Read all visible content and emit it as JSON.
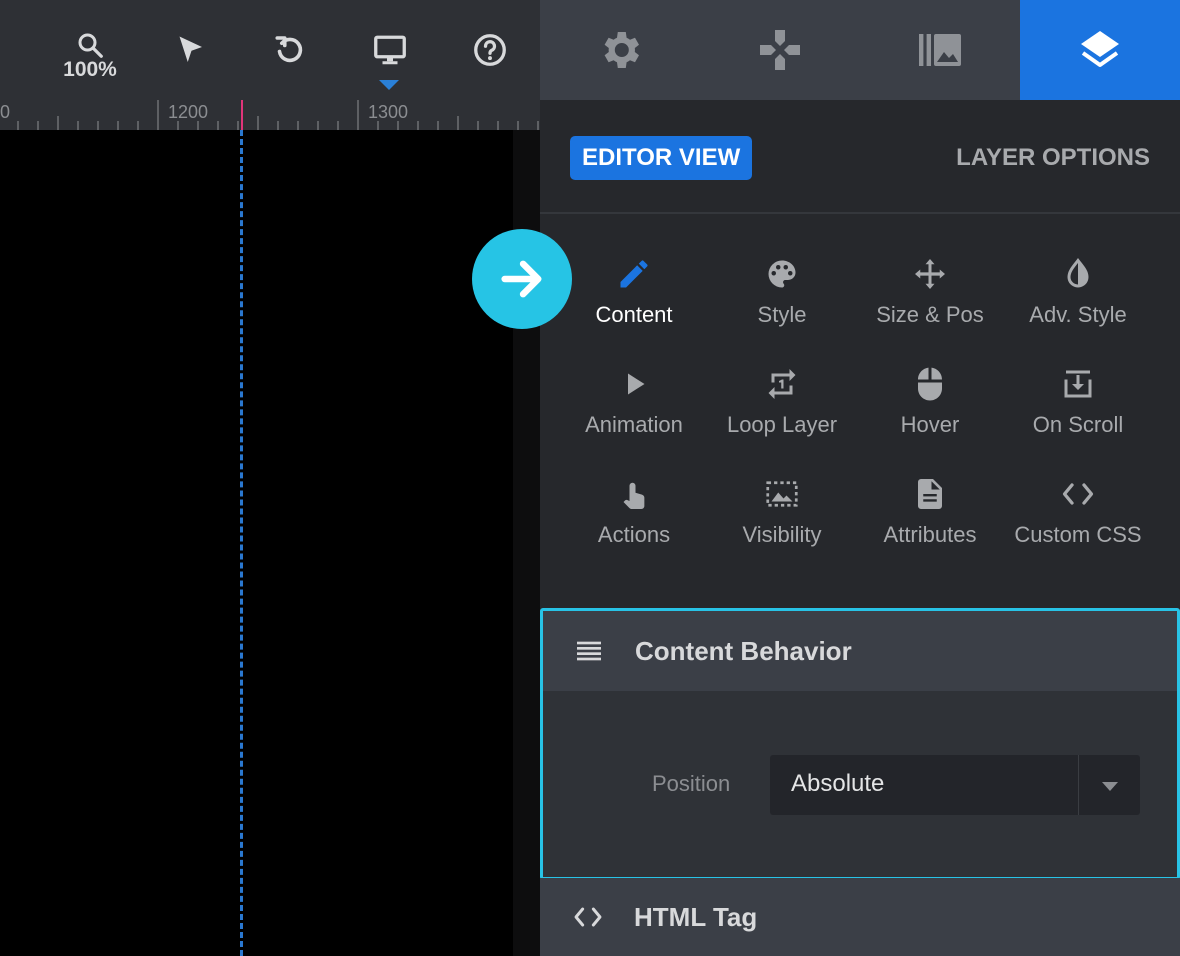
{
  "toolbar": {
    "zoom_label": "100%",
    "tools": [
      "search-zoom-icon",
      "select-arrow-icon",
      "undo-icon",
      "desktop-icon",
      "help-icon"
    ]
  },
  "ruler": {
    "labels": [
      "0",
      "1200",
      "1300"
    ]
  },
  "panel_tabs": [
    "settings-icon",
    "gamepad-icon",
    "media-library-icon",
    "layers-icon"
  ],
  "panel": {
    "editor_view_label": "EDITOR VIEW",
    "layer_options_label": "LAYER OPTIONS",
    "options": [
      {
        "label": "Content",
        "icon": "pencil-icon",
        "active": true
      },
      {
        "label": "Style",
        "icon": "palette-icon"
      },
      {
        "label": "Size & Pos",
        "icon": "move-icon"
      },
      {
        "label": "Adv. Style",
        "icon": "contrast-icon"
      },
      {
        "label": "Animation",
        "icon": "play-icon"
      },
      {
        "label": "Loop Layer",
        "icon": "repeat-one-icon"
      },
      {
        "label": "Hover",
        "icon": "mouse-icon"
      },
      {
        "label": "On Scroll",
        "icon": "download-box-icon"
      },
      {
        "label": "Actions",
        "icon": "touch-icon"
      },
      {
        "label": "Visibility",
        "icon": "image-dashed-icon"
      },
      {
        "label": "Attributes",
        "icon": "document-icon"
      },
      {
        "label": "Custom CSS",
        "icon": "code-icon"
      }
    ],
    "content_behavior": {
      "title": "Content Behavior",
      "position_label": "Position",
      "position_value": "Absolute"
    },
    "html_tag": {
      "title": "HTML Tag"
    }
  },
  "colors": {
    "accent_blue": "#1b74e0",
    "highlight_cyan": "#28c3e6",
    "guide_blue": "#2a78d0",
    "marker_pink": "#e0357a"
  }
}
